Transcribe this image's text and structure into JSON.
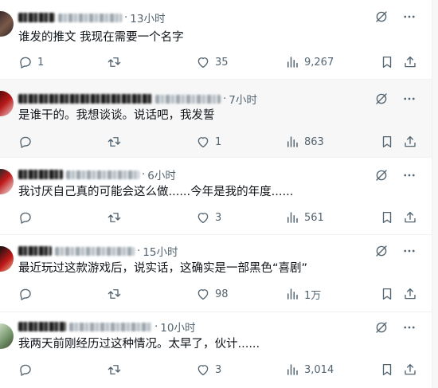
{
  "tweets": [
    {
      "time": "13小时",
      "text": "谁发的推文 我现在需要一个名字",
      "replies": "1",
      "retweets": "",
      "likes": "35",
      "views": "9,267"
    },
    {
      "time": "7小时",
      "text": "是谁干的。我想谈谈。说话吧，我发誓",
      "replies": "",
      "retweets": "",
      "likes": "1",
      "views": "863"
    },
    {
      "time": "6小时",
      "text": "我讨厌自己真的可能会这么做......今年是我的年度......",
      "replies": "",
      "retweets": "",
      "likes": "3",
      "views": "561"
    },
    {
      "time": "15小时",
      "text": "最近玩过这款游戏后，说实话，这确实是一部黑色“喜剧”",
      "replies": "",
      "retweets": "",
      "likes": "98",
      "views": "1万"
    },
    {
      "time": "10小时",
      "text": "我两天前刚经历过这种情况。太早了，伙计......",
      "replies": "",
      "retweets": "",
      "likes": "3",
      "views": "3,014"
    }
  ],
  "icons": {
    "reply": "reply-icon",
    "retweet": "retweet-icon",
    "like": "heart-icon",
    "views": "views-icon",
    "bookmark": "bookmark-icon",
    "share": "share-icon",
    "grok": "grok-icon",
    "more": "more-icon"
  },
  "colors": {
    "text": "#0f1419",
    "muted": "#536471",
    "hover_bg": "#f7f7f7",
    "divider": "#eff3f4"
  }
}
